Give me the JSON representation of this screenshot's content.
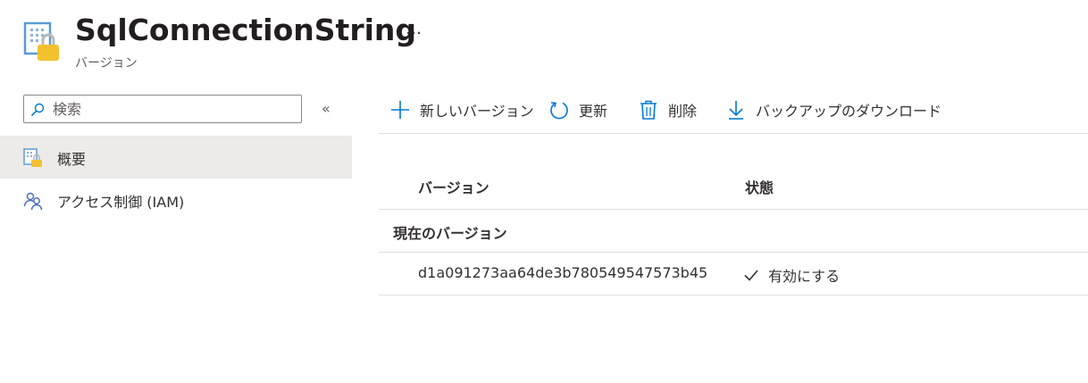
{
  "header": {
    "title": "SqlConnectionString",
    "subtitle": "バージョン",
    "more_label": "…",
    "resource_icon": "key-vault-secret-icon"
  },
  "sidebar": {
    "search_placeholder": "検索",
    "collapse_label": "«",
    "items": [
      {
        "label": "概要",
        "icon": "overview-icon",
        "active": true
      },
      {
        "label": "アクセス制御 (IAM)",
        "icon": "people-icon",
        "active": false
      }
    ]
  },
  "toolbar": {
    "new_version": "新しいバージョン",
    "refresh": "更新",
    "delete": "削除",
    "download_backup": "バックアップのダウンロード"
  },
  "grid": {
    "columns": [
      "バージョン",
      "状態"
    ],
    "group_label": "現在のバージョン",
    "rows": [
      {
        "version": "d1a091273aa64de3b780549547573b45",
        "status": "有効にする"
      }
    ]
  },
  "colors": {
    "accent": "#0078d4",
    "lock": "#f2c12e",
    "active_bg": "#edebe9",
    "divider": "#e1dfdd"
  }
}
